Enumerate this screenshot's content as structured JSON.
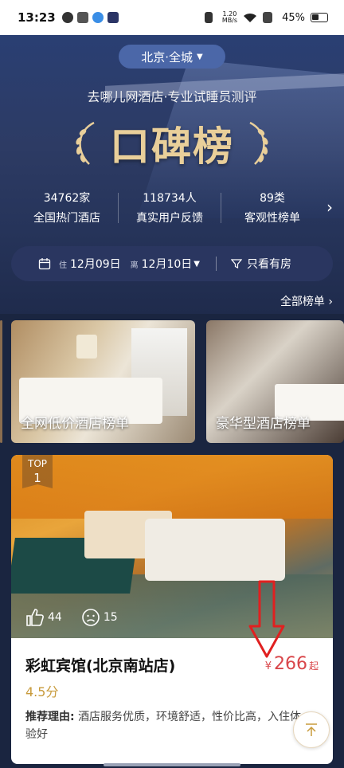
{
  "status_bar": {
    "time": "13:23",
    "net_speed_top": "1.20",
    "net_speed_bottom": "MB/s",
    "battery": "45%"
  },
  "hero": {
    "city": "北京·全城",
    "subtitle": "去哪儿网酒店·专业试睡员测评",
    "title": "口碑榜",
    "stats": [
      {
        "num": "34762家",
        "label": "全国热门酒店"
      },
      {
        "num": "118734人",
        "label": "真实用户反馈"
      },
      {
        "num": "89类",
        "label": "客观性榜单"
      }
    ]
  },
  "date_bar": {
    "checkin_tag": "住",
    "checkin": "12月09日",
    "checkout_tag": "离",
    "checkout": "12月10日",
    "filter": "只看有房"
  },
  "all_lists": "全部榜单",
  "categories": [
    {
      "label": "全网低价酒店榜单"
    },
    {
      "label": "豪华型酒店榜单"
    }
  ],
  "hotel": {
    "badge_top": "TOP",
    "badge_rank": "1",
    "likes": "44",
    "dislikes": "15",
    "name": "彩虹宾馆(北京南站店)",
    "score": "4.5分",
    "price_currency": "¥",
    "price": "266",
    "price_suffix": "起",
    "reason_label": "推荐理由:",
    "reason": "酒店服务优质，环境舒适，性价比高，入住体验好"
  },
  "colors": {
    "accent_gold": "#e9cf9a",
    "price_red": "#d9464a",
    "score_gold": "#c89b3c",
    "hero_blue": "#2d3b64"
  }
}
